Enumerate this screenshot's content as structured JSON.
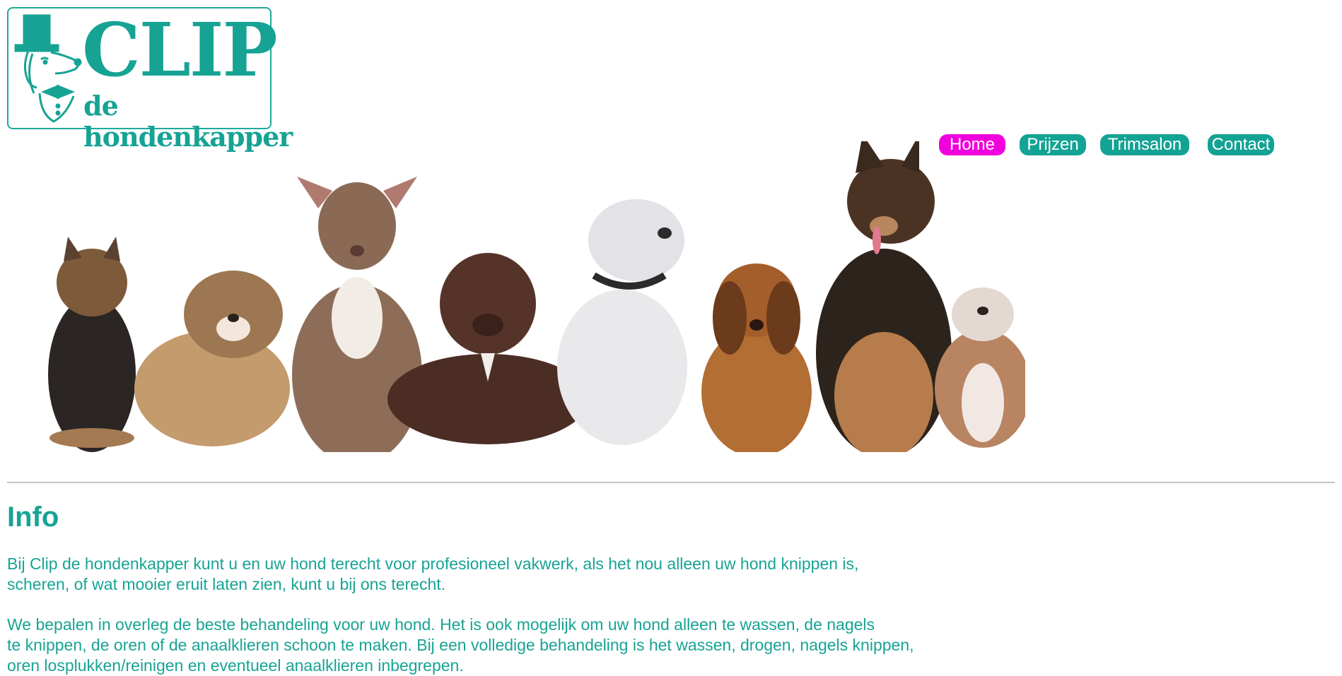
{
  "logo": {
    "title": "CLIP",
    "subtitle": "de hondenkapper"
  },
  "nav": {
    "items": [
      {
        "label": "Home",
        "active": true
      },
      {
        "label": "Prijzen",
        "active": false
      },
      {
        "label": "Trimsalon",
        "active": false
      },
      {
        "label": "Contact",
        "active": false
      }
    ]
  },
  "content": {
    "title": "Info",
    "paragraph1": "Bij Clip de hondenkapper kunt u en uw hond terecht voor profesioneel vakwerk, als het nou alleen uw hond knippen is,\nscheren, of wat mooier eruit laten zien, kunt u bij ons terecht.",
    "paragraph2": "We bepalen in overleg de beste behandeling voor uw hond. Het is ook mogelijk om uw hond alleen te wassen, de nagels\nte knippen, de oren of de anaalklieren schoon te maken. Bij een volledige behandeling is het wassen, drogen, nagels knippen,\noren losplukken/reinigen en eventueel anaalklieren inbegrepen."
  },
  "colors": {
    "accent": "#18a394",
    "active_nav": "#f000dc"
  }
}
